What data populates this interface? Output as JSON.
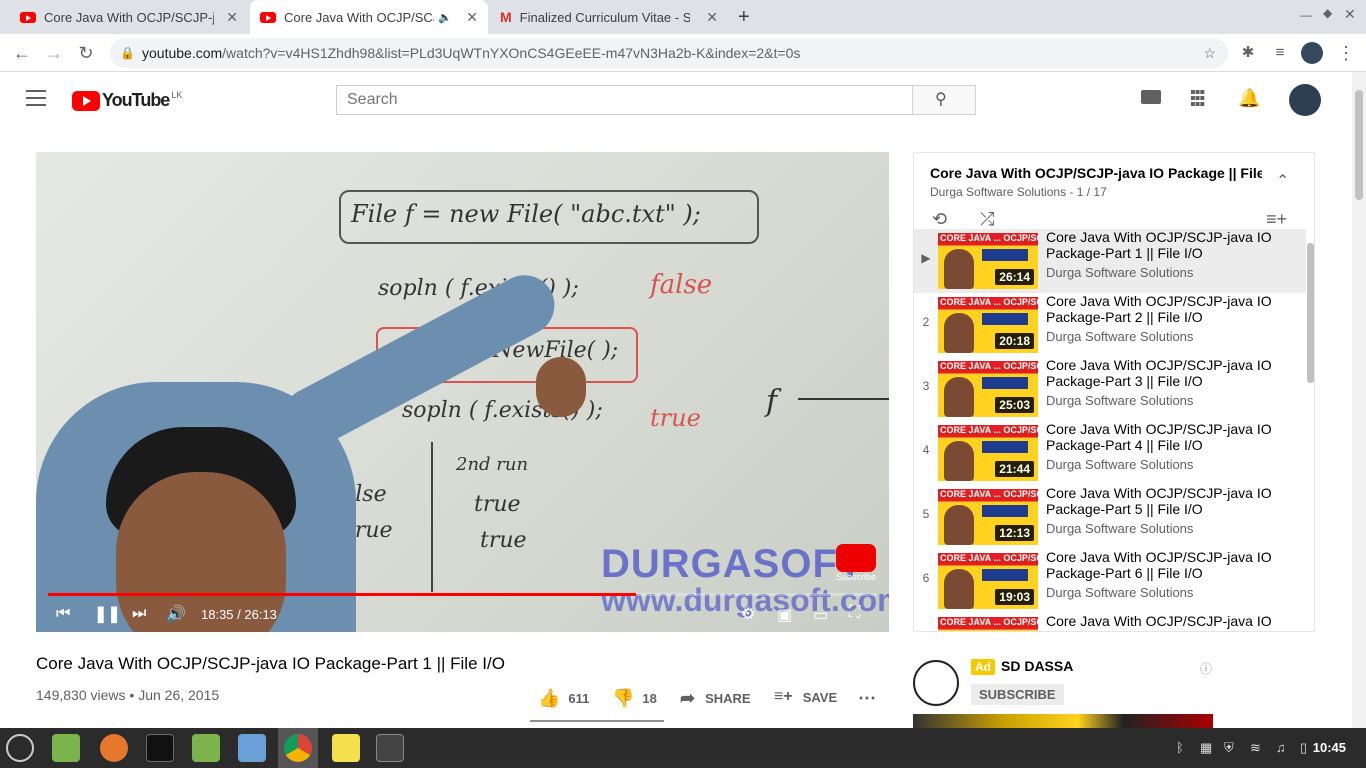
{
  "browser": {
    "tabs": [
      {
        "title": "Core Java With OCJP/SCJP-ja",
        "favicon": "youtube-icon",
        "active": false
      },
      {
        "title": "Core Java With OCJP/SCJ",
        "favicon": "youtube-icon",
        "active": true,
        "audio": true
      },
      {
        "title": "Finalized Curriculum Vitae - Sh",
        "favicon": "gmail-icon",
        "active": false
      }
    ],
    "url_host": "youtube.com",
    "url_rest": "/watch?v=v4HS1Zhdh98&list=PLd3UqWTnYXOnCS4GEeEE-m47vN3Ha2b-K&index=2&t=0s"
  },
  "youtube": {
    "logo_text": "YouTube",
    "region": "LK",
    "search_placeholder": "Search"
  },
  "player": {
    "current_time": "18:35",
    "duration": "26:13",
    "time_display": "18:35 / 26:13",
    "progress_fraction": 0.709,
    "watermark": "DURGASOFT",
    "watermark_url": "www.durgasoft.com",
    "subscribe_label": "Subscribe",
    "board": {
      "line1": "File  f = new  File( \"abc.txt\" );",
      "line2": "sopln ( f.exists() );",
      "line2_result": "false",
      "line3": "f.createNewFile( );",
      "line4": "sopln ( f.exists() );",
      "line4_result": "true",
      "right_label": "f",
      "col2_head": "2nd  run",
      "col1": [
        "false",
        "true"
      ],
      "col2": [
        "true",
        "true"
      ]
    }
  },
  "video": {
    "title": "Core Java With OCJP/SCJP-java IO Package-Part 1 || File I/O",
    "views": "149,830 views",
    "date": "Jun 26, 2015",
    "likes": "611",
    "dislikes": "18",
    "share_label": "SHARE",
    "save_label": "SAVE"
  },
  "playlist": {
    "title": "Core Java With OCJP/SCJP-java IO Package || File I/O",
    "channel": "Durga Software Solutions",
    "position": "1 / 17",
    "items": [
      {
        "index": "▶",
        "title": "Core Java With OCJP/SCJP-java IO Package-Part 1 || File I/O",
        "channel": "Durga Software Solutions",
        "duration": "26:14",
        "current": true
      },
      {
        "index": "2",
        "title": "Core Java With OCJP/SCJP-java IO Package-Part 2 || File I/O",
        "channel": "Durga Software Solutions",
        "duration": "20:18"
      },
      {
        "index": "3",
        "title": "Core Java With OCJP/SCJP-java IO Package-Part 3 || File I/O",
        "channel": "Durga Software Solutions",
        "duration": "25:03"
      },
      {
        "index": "4",
        "title": "Core Java With OCJP/SCJP-java IO Package-Part 4 || File I/O",
        "channel": "Durga Software Solutions",
        "duration": "21:44"
      },
      {
        "index": "5",
        "title": "Core Java With OCJP/SCJP-java IO Package-Part 5 || File I/O",
        "channel": "Durga Software Solutions",
        "duration": "12:13"
      },
      {
        "index": "6",
        "title": "Core Java With OCJP/SCJP-java IO Package-Part 6 || File I/O",
        "channel": "Durga Software Solutions",
        "duration": "19:03"
      },
      {
        "index": "",
        "title": "Core Java With OCJP/SCJP-java IO",
        "channel": "",
        "duration": ""
      }
    ],
    "thumb_text": "CORE JAVA ... OCJP/SCJP"
  },
  "ad": {
    "badge": "Ad",
    "name": "SD DASSA",
    "subscribe": "SUBSCRIBE"
  },
  "taskbar": {
    "clock": "10:45"
  },
  "colors": {
    "yt_red": "#ff0000",
    "accent": "#065fd4"
  }
}
